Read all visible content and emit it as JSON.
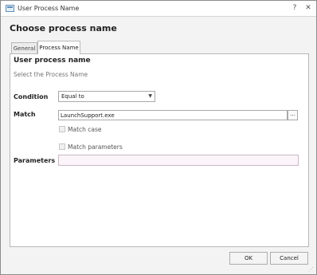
{
  "window": {
    "title": "User Process Name",
    "help_icon": "pin-icon",
    "close_icon": "close-icon"
  },
  "dialog": {
    "title": "Choose process name"
  },
  "tabs": [
    {
      "label": "General",
      "active": false
    },
    {
      "label": "Process Name",
      "active": true
    }
  ],
  "panel": {
    "section_title": "User process name",
    "section_subtitle": "Select the Process Name",
    "condition": {
      "label": "Condition",
      "value": "Equal to"
    },
    "match": {
      "label": "Match",
      "value": "LaunchSupport.exe",
      "browse_label": "..."
    },
    "match_case": {
      "label": "Match case",
      "checked": false
    },
    "match_parameters": {
      "label": "Match parameters",
      "checked": false
    },
    "parameters": {
      "label": "Parameters",
      "value": ""
    }
  },
  "footer": {
    "ok_label": "OK",
    "cancel_label": "Cancel"
  },
  "colors": {
    "title_bar": "#ffffff",
    "window_bg": "#f3f3f3",
    "panel_bg": "#ffffff",
    "params_bg": "#fbf4f9"
  }
}
